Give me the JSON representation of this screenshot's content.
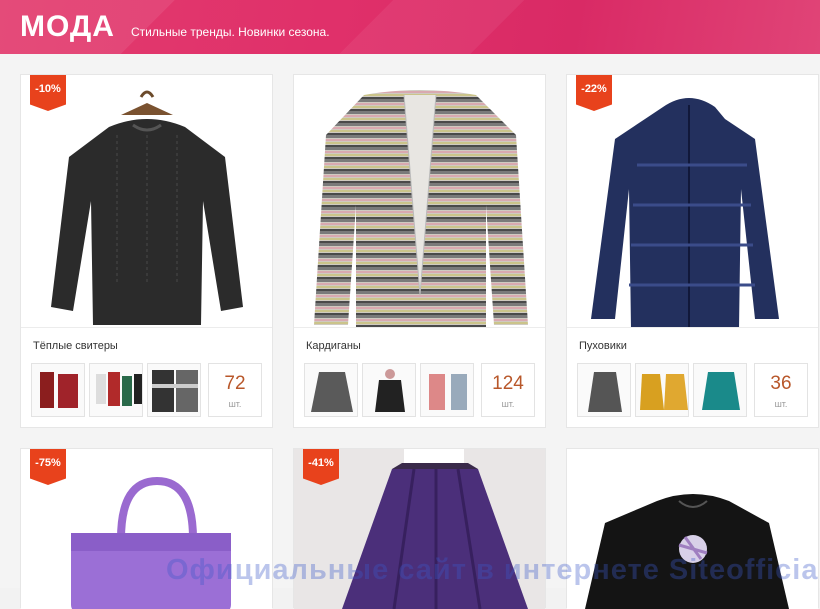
{
  "header": {
    "brand": "МОДА",
    "tagline": "Стильные тренды. Новинки сезона."
  },
  "cards": [
    {
      "badge": "-10%",
      "title": "Тёплые свитеры",
      "count": "72",
      "unit": "шт.",
      "image": "black-sweater"
    },
    {
      "badge": "",
      "title": "Кардиганы",
      "count": "124",
      "unit": "шт.",
      "image": "striped-cardigan"
    },
    {
      "badge": "-22%",
      "title": "Пуховики",
      "count": "36",
      "unit": "шт.",
      "image": "navy-puffer-jacket"
    },
    {
      "badge": "-75%",
      "image": "purple-handbag"
    },
    {
      "badge": "-41%",
      "image": "purple-skirt"
    },
    {
      "badge": "",
      "image": "black-printed-top"
    }
  ],
  "watermark": "Официальные сайт в интернете Siteofficial.ru"
}
